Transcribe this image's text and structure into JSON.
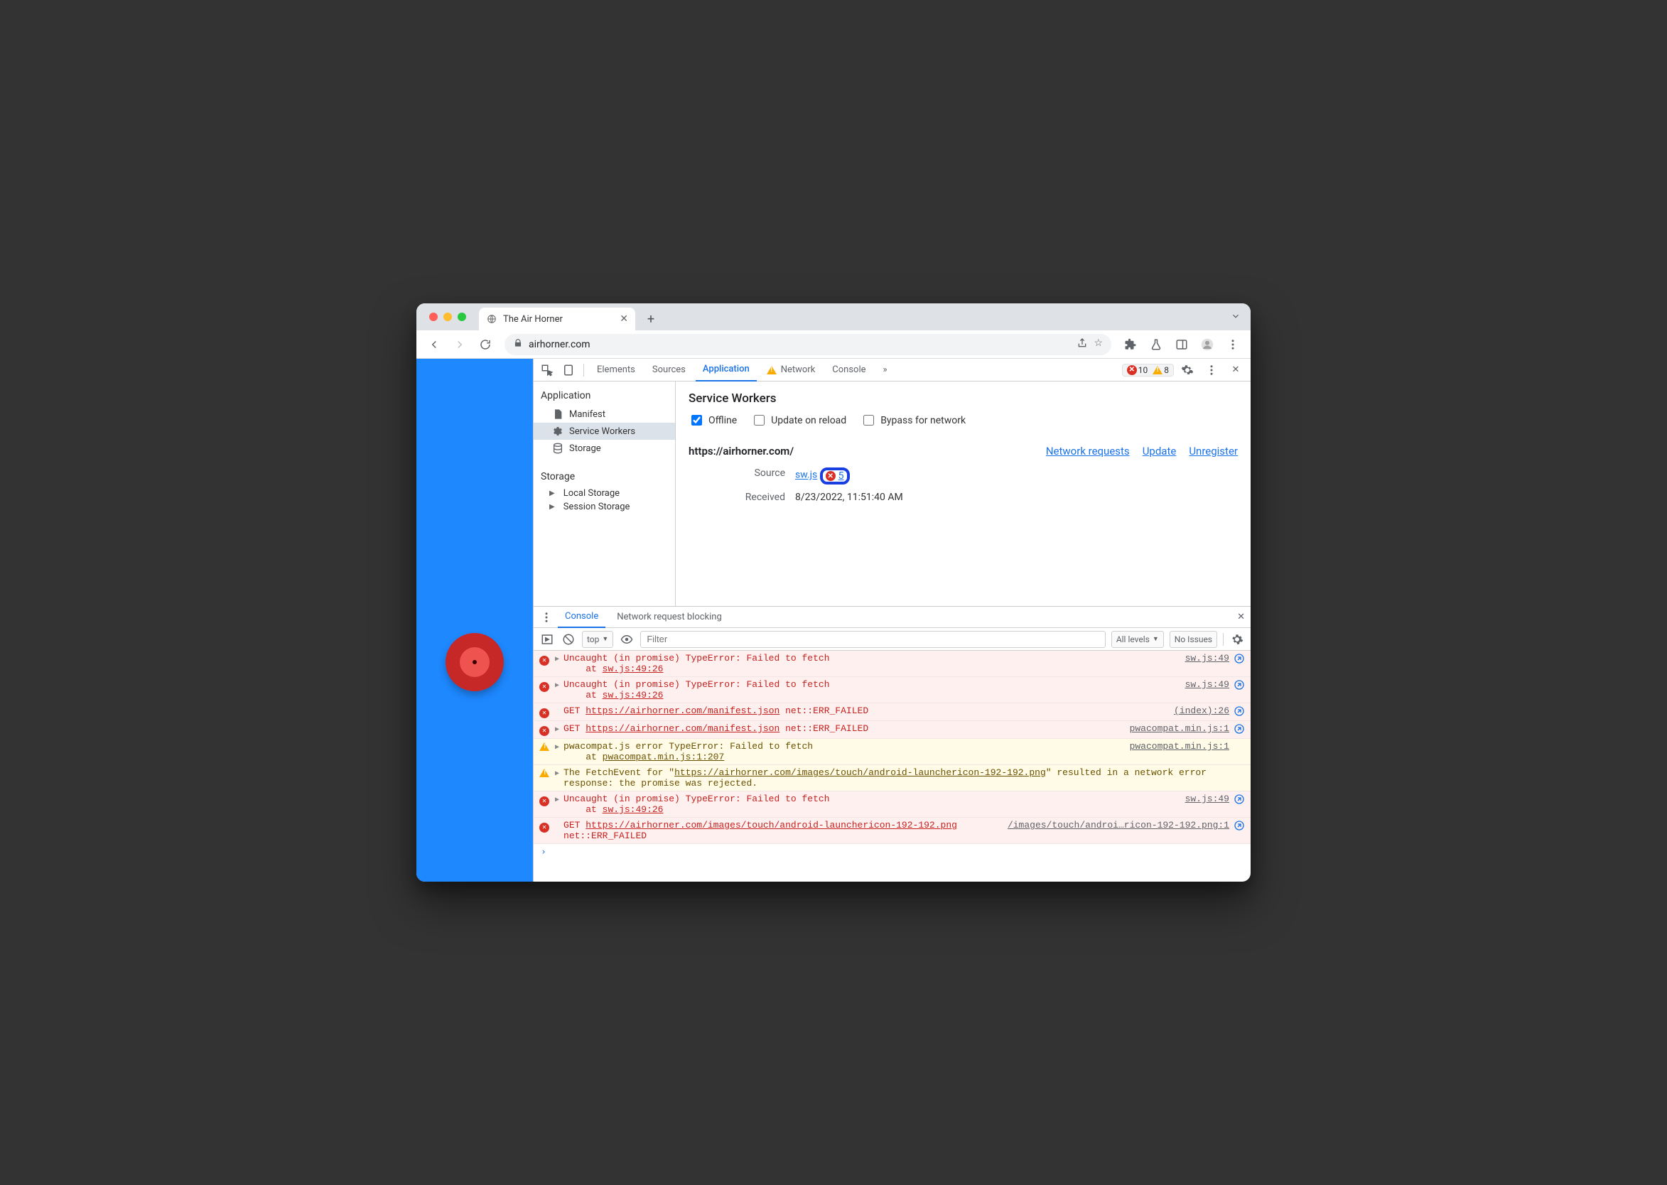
{
  "tab": {
    "title": "The Air Horner"
  },
  "omnibox": {
    "url": "airhorner.com"
  },
  "devtools": {
    "tabs": [
      "Elements",
      "Sources",
      "Application",
      "Network",
      "Console"
    ],
    "active_tab": "Application",
    "errors": "10",
    "warnings": "8"
  },
  "sidebar": {
    "sections": {
      "application": {
        "label": "Application",
        "items": [
          {
            "label": "Manifest",
            "icon": "file"
          },
          {
            "label": "Service Workers",
            "icon": "gear",
            "selected": true
          },
          {
            "label": "Storage",
            "icon": "db"
          }
        ]
      },
      "storage": {
        "label": "Storage",
        "items": [
          {
            "label": "Local Storage",
            "icon": "grid"
          },
          {
            "label": "Session Storage",
            "icon": "grid"
          }
        ]
      }
    }
  },
  "service_workers": {
    "heading": "Service Workers",
    "opts": {
      "offline": {
        "label": "Offline",
        "checked": true
      },
      "update": {
        "label": "Update on reload",
        "checked": false
      },
      "bypass": {
        "label": "Bypass for network",
        "checked": false
      }
    },
    "origin": "https://airhorner.com/",
    "links": {
      "network": "Network requests",
      "update": "Update",
      "unregister": "Unregister"
    },
    "source": {
      "label": "Source",
      "file": "sw.js",
      "errcount": "5"
    },
    "received": {
      "label": "Received",
      "value": "8/23/2022, 11:51:40 AM"
    }
  },
  "drawer": {
    "tabs": {
      "console": "Console",
      "nrb": "Network request blocking"
    },
    "toolbar": {
      "context": "top",
      "filter_placeholder": "Filter",
      "levels": "All levels",
      "issues": "No Issues"
    }
  },
  "console": {
    "rows": [
      {
        "type": "err",
        "caret": true,
        "msg_a": "Uncaught (in promise) TypeError: Failed to fetch",
        "msg_b": "at ",
        "msg_link": "sw.js:49:26",
        "src": "sw.js:49"
      },
      {
        "type": "err",
        "caret": true,
        "msg_a": "Uncaught (in promise) TypeError: Failed to fetch",
        "msg_b": "at ",
        "msg_link": "sw.js:49:26",
        "src": "sw.js:49"
      },
      {
        "type": "err",
        "caret": false,
        "prefix": "GET ",
        "url": "https://airhorner.com/manifest.json",
        "suffix": " net::ERR_FAILED",
        "src": "(index):26"
      },
      {
        "type": "err",
        "caret": true,
        "prefix": "GET ",
        "url": "https://airhorner.com/manifest.json",
        "suffix": " net::ERR_FAILED",
        "src": "pwacompat.min.js:1"
      },
      {
        "type": "warn",
        "caret": true,
        "msg_a": "pwacompat.js error TypeError: Failed to fetch",
        "msg_b": "at ",
        "msg_link": "pwacompat.min.js:1:207",
        "src": "pwacompat.min.js:1"
      },
      {
        "type": "warn",
        "caret": true,
        "long_a": "The FetchEvent for \"",
        "long_link": "https://airhorner.com/images/touch/android-launchericon-192-192.png",
        "long_b": "\" resulted in a network error response: the promise was rejected.",
        "src": ""
      },
      {
        "type": "err",
        "caret": true,
        "msg_a": "Uncaught (in promise) TypeError: Failed to fetch",
        "msg_b": "at ",
        "msg_link": "sw.js:49:26",
        "src": "sw.js:49"
      },
      {
        "type": "err",
        "caret": false,
        "prefix": "GET ",
        "url": "https://airhorner.com/images/touch/android-launchericon-192-192.png",
        "suffix": " net::ERR_FAILED",
        "src": "/images/touch/androi…ricon-192-192.png:1"
      }
    ]
  }
}
